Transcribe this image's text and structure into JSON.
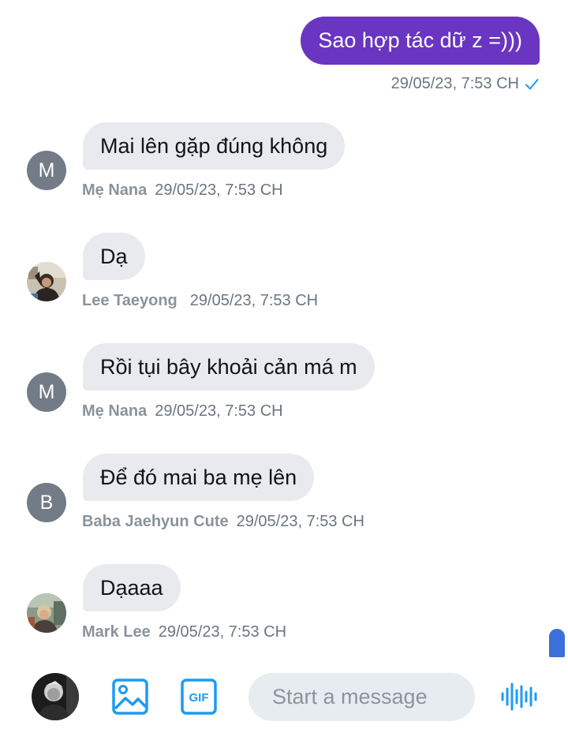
{
  "outgoing": {
    "text": "Sao hợp tác dữ z =)))",
    "timestamp": "29/05/23, 7:53 CH",
    "status_icon": "check-icon"
  },
  "messages": [
    {
      "avatar_type": "letter",
      "avatar_letter": "M",
      "text": "Mai lên gặp đúng không",
      "sender": "Mẹ Nana",
      "timestamp": "29/05/23, 7:53 CH"
    },
    {
      "avatar_type": "photo",
      "avatar_letter": "",
      "text": "Dạ",
      "sender": "Lee Taeyong",
      "timestamp": "29/05/23, 7:53 CH"
    },
    {
      "avatar_type": "letter",
      "avatar_letter": "M",
      "text": "Rồi tụi bây khoải cản má m",
      "sender": "Mẹ Nana",
      "timestamp": "29/05/23, 7:53 CH"
    },
    {
      "avatar_type": "letter",
      "avatar_letter": "B",
      "text": "Để đó mai ba mẹ lên",
      "sender": "Baba Jaehyun Cute",
      "timestamp": "29/05/23, 7:53 CH"
    },
    {
      "avatar_type": "photo",
      "avatar_letter": "",
      "text": "Dạaaa",
      "sender": "Mark Lee",
      "timestamp": "29/05/23, 7:53 CH"
    }
  ],
  "composer": {
    "placeholder": "Start a message",
    "value": "",
    "image_icon": "image-icon",
    "gif_icon": "gif-icon",
    "gif_label": "GIF",
    "voice_icon": "voice-wave-icon"
  },
  "colors": {
    "outgoing_bubble": "#6a35c0",
    "incoming_bubble": "#e8eaee",
    "accent": "#1d9bf0",
    "letter_avatar": "#737b86"
  }
}
